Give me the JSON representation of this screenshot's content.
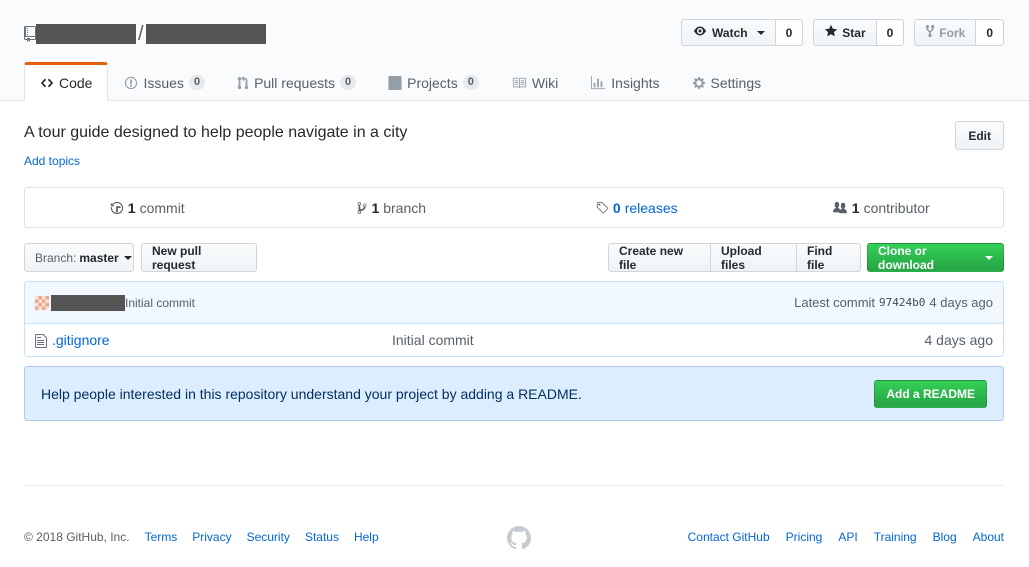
{
  "header": {
    "owner_redacted": "",
    "separator": "/",
    "repo_redacted": "",
    "watch": {
      "label": "Watch",
      "count": "0"
    },
    "star": {
      "label": "Star",
      "count": "0"
    },
    "fork": {
      "label": "Fork",
      "count": "0"
    }
  },
  "nav": [
    {
      "label": "Code",
      "icon": "code-icon",
      "counter": null
    },
    {
      "label": "Issues",
      "icon": "issue-icon",
      "counter": "0"
    },
    {
      "label": "Pull requests",
      "icon": "pull-request-icon",
      "counter": "0"
    },
    {
      "label": "Projects",
      "icon": "project-icon",
      "counter": "0"
    },
    {
      "label": "Wiki",
      "icon": "book-icon",
      "counter": null
    },
    {
      "label": "Insights",
      "icon": "graph-icon",
      "counter": null
    },
    {
      "label": "Settings",
      "icon": "gear-icon",
      "counter": null
    }
  ],
  "repo": {
    "description": "A tour guide designed to help people navigate in a city",
    "add_topics": "Add topics",
    "edit_label": "Edit"
  },
  "summary": {
    "commits": {
      "num": "1",
      "label": "commit"
    },
    "branches": {
      "num": "1",
      "label": "branch"
    },
    "releases": {
      "num": "0",
      "label": "releases"
    },
    "contributors": {
      "num": "1",
      "label": "contributor"
    }
  },
  "file_nav": {
    "branch_prefix": "Branch:",
    "branch_name": "master",
    "new_pr": "New pull request",
    "create_file": "Create new file",
    "upload_files": "Upload files",
    "find_file": "Find file",
    "clone": "Clone or download"
  },
  "commit": {
    "message": "Initial commit",
    "latest_label": "Latest commit",
    "sha": "97424b0",
    "age": "4 days ago"
  },
  "files": [
    {
      "name": ".gitignore",
      "message": "Initial commit",
      "age": "4 days ago"
    }
  ],
  "readme_prompt": {
    "text": "Help people interested in this repository understand your project by adding a README.",
    "button": "Add a README"
  },
  "footer": {
    "copyright": "© 2018 GitHub, Inc.",
    "left_links": [
      "Terms",
      "Privacy",
      "Security",
      "Status",
      "Help"
    ],
    "right_links": [
      "Contact GitHub",
      "Pricing",
      "API",
      "Training",
      "Blog",
      "About"
    ]
  },
  "colors": {
    "link": "#0366d6",
    "accent_tab": "#e36209",
    "primary_green": "#28a745",
    "flash_blue": "#dbedff"
  }
}
